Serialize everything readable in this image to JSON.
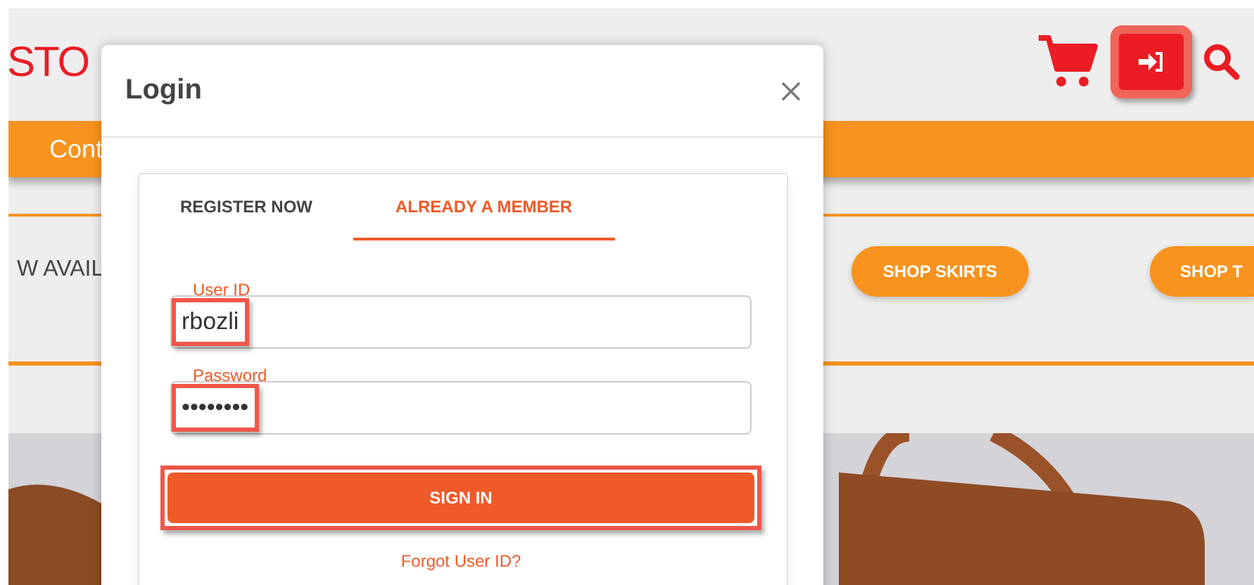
{
  "header": {
    "logo": "STO",
    "login_highlighted": true
  },
  "nav": {
    "items": [
      "Cont"
    ]
  },
  "promo": {
    "text": "W AVAIL",
    "buttons": [
      "SHOP SKIRTS",
      "SHOP T"
    ]
  },
  "dialog": {
    "title": "Login",
    "tabs": [
      {
        "label": "REGISTER NOW",
        "selected": false
      },
      {
        "label": "ALREADY A MEMBER",
        "selected": true
      }
    ],
    "fields": [
      {
        "label": "User ID",
        "value": "rbozli",
        "highlighted": true
      },
      {
        "label": "Password",
        "value": "••••••••",
        "highlighted": true
      }
    ],
    "submit": {
      "label": "SIGN IN",
      "highlighted": true
    },
    "link": "Forgot User ID?"
  }
}
